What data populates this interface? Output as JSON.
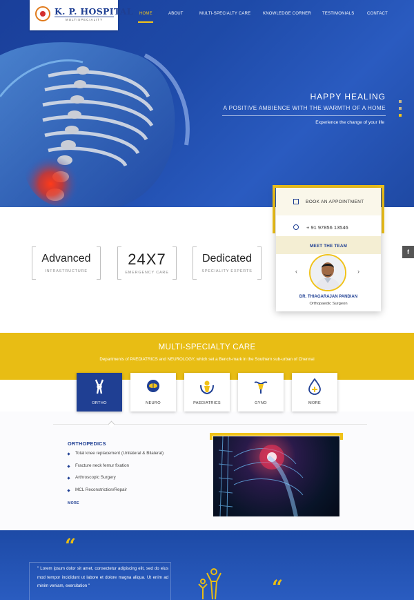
{
  "header": {
    "logo_name": "K. P. HOSPITAL",
    "logo_sub": "MULTISPECIALITY",
    "nav": [
      "HOME",
      "ABOUT",
      "MULTI-SPECIALTY CARE",
      "KNOWLEDGE CORNER",
      "TESTIMONIALS",
      "CONTACT"
    ],
    "active_nav": "HOME"
  },
  "hero": {
    "title": "HAPPY HEALING",
    "subtitle": "A POSITIVE AMBIENCE WITH THE WARMTH OF A HOME",
    "tagline": "Experience the change of your life",
    "slides": 3,
    "active_slide": 3
  },
  "stats": [
    {
      "big": "Advanced",
      "small": "INFRASTRUCTURE"
    },
    {
      "big": "24X7",
      "small": "EMERGENCY CARE"
    },
    {
      "big": "Dedicated",
      "small": "SPECIALITY EXPERTS"
    }
  ],
  "appointment": {
    "book_label": "BOOK AN APPOINTMENT",
    "phone": "+ 91 97856 13546",
    "team_label": "MEET THE TEAM",
    "doctor_name": "DR. THIAGARAJAN PANDIAN",
    "doctor_role": "Orthopaedic Surgeon"
  },
  "social": {
    "facebook": "f"
  },
  "specialty": {
    "title": "MULTI-SPECIALTY CARE",
    "subtitle": "Departments of PAEDIATRICS and NEUROLOGY, which set a Bench-mark in the Southern sub-urban of Chennai",
    "tiles": [
      "ORTHO",
      "NEURO",
      "PAEDIATRICS",
      "GYNO",
      "MORE"
    ],
    "active_tile": "ORTHO"
  },
  "ortho": {
    "title": "ORTHOPEDICS",
    "items": [
      "Total knee replacement (Unilateral & Bilateral)",
      "Fracture neck femur fixation",
      "Arthroscopic Surgery",
      "MCL Reconstriction/Repair"
    ],
    "more": "MORE"
  },
  "testimonial": {
    "quote_mark": "“",
    "text": "\" Lorem ipsum dolor sit amet, consectetur adipiscing elit, sed do eius mod tempor incididunt ut labore et dolore magna aliqua. Ut enim ad minim veniam, exercitation \""
  },
  "colors": {
    "brand_blue": "#1f3f93",
    "accent_yellow": "#f0c21a",
    "hero_blue": "#1e4aa8"
  }
}
